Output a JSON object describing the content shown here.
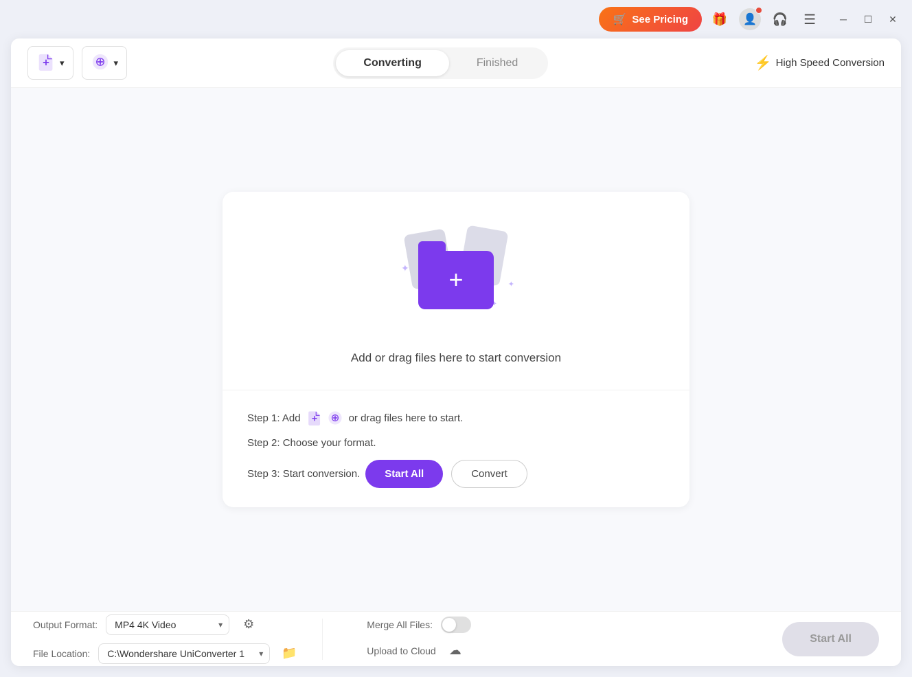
{
  "titlebar": {
    "see_pricing_label": "See Pricing",
    "menu_icon": "☰",
    "minimize_icon": "─",
    "maximize_icon": "☐",
    "close_icon": "✕"
  },
  "toolbar": {
    "converting_tab": "Converting",
    "finished_tab": "Finished",
    "speed_label": "High Speed Conversion"
  },
  "dropzone": {
    "hint": "Add or drag files here to start conversion"
  },
  "steps": {
    "step1_prefix": "Step 1: Add",
    "step1_suffix": "or drag files here to start.",
    "step2": "Step 2: Choose your format.",
    "step3_prefix": "Step 3: Start conversion.",
    "start_all_label": "Start All",
    "convert_label": "Convert"
  },
  "bottom": {
    "output_format_label": "Output Format:",
    "output_format_value": "MP4 4K Video",
    "file_location_label": "File Location:",
    "file_location_value": "C:\\Wondershare UniConverter 1",
    "merge_files_label": "Merge All Files:",
    "upload_cloud_label": "Upload to Cloud",
    "start_all_label": "Start All"
  }
}
